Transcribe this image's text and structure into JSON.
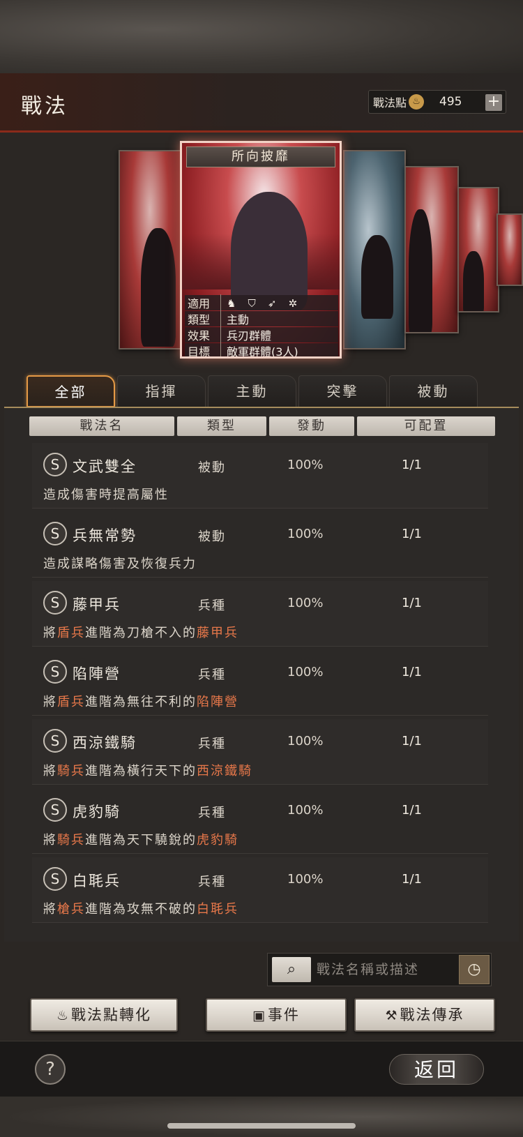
{
  "header": {
    "title": "戰法",
    "points_label": "戰法點",
    "points_icon": "flame-coin-icon",
    "points_value": "495",
    "points_add": "+"
  },
  "featured_card": {
    "title": "所向披靡",
    "info": [
      {
        "key": "適用",
        "value": ""
      },
      {
        "key": "類型",
        "value": "主動"
      },
      {
        "key": "效果",
        "value": "兵刃群體"
      },
      {
        "key": "目標",
        "value": "敵軍群體(3人)"
      }
    ],
    "applicable_icons": [
      "cavalry-icon",
      "shield-icon",
      "bow-icon",
      "spear-icon"
    ]
  },
  "tabs": [
    {
      "label": "全部",
      "active": true
    },
    {
      "label": "指揮",
      "active": false
    },
    {
      "label": "主動",
      "active": false
    },
    {
      "label": "突擊",
      "active": false
    },
    {
      "label": "被動",
      "active": false
    }
  ],
  "columns": [
    "戰法名",
    "類型",
    "發動",
    "可配置"
  ],
  "rows": [
    {
      "grade": "S",
      "name": "文武雙全",
      "type": "被動",
      "rate": "100%",
      "slot": "1/1",
      "desc": [
        {
          "t": "造成傷害時提高屬性",
          "h": false
        }
      ]
    },
    {
      "grade": "S",
      "name": "兵無常勢",
      "type": "被動",
      "rate": "100%",
      "slot": "1/1",
      "desc": [
        {
          "t": "造成謀略傷害及恢復兵力",
          "h": false
        }
      ]
    },
    {
      "grade": "S",
      "name": "藤甲兵",
      "type": "兵種",
      "rate": "100%",
      "slot": "1/1",
      "desc": [
        {
          "t": "將",
          "h": false
        },
        {
          "t": "盾兵",
          "h": true
        },
        {
          "t": "進階為刀槍不入的",
          "h": false
        },
        {
          "t": "藤甲兵",
          "h": true
        }
      ]
    },
    {
      "grade": "S",
      "name": "陷陣營",
      "type": "兵種",
      "rate": "100%",
      "slot": "1/1",
      "desc": [
        {
          "t": "將",
          "h": false
        },
        {
          "t": "盾兵",
          "h": true
        },
        {
          "t": "進階為無往不利的",
          "h": false
        },
        {
          "t": "陷陣營",
          "h": true
        }
      ]
    },
    {
      "grade": "S",
      "name": "西涼鐵騎",
      "type": "兵種",
      "rate": "100%",
      "slot": "1/1",
      "desc": [
        {
          "t": "將",
          "h": false
        },
        {
          "t": "騎兵",
          "h": true
        },
        {
          "t": "進階為橫行天下的",
          "h": false
        },
        {
          "t": "西涼鐵騎",
          "h": true
        }
      ]
    },
    {
      "grade": "S",
      "name": "虎豹騎",
      "type": "兵種",
      "rate": "100%",
      "slot": "1/1",
      "desc": [
        {
          "t": "將",
          "h": false
        },
        {
          "t": "騎兵",
          "h": true
        },
        {
          "t": "進階為天下驍銳的",
          "h": false
        },
        {
          "t": "虎豹騎",
          "h": true
        }
      ]
    },
    {
      "grade": "S",
      "name": "白毦兵",
      "type": "兵種",
      "rate": "100%",
      "slot": "1/1",
      "desc": [
        {
          "t": "將",
          "h": false
        },
        {
          "t": "槍兵",
          "h": true
        },
        {
          "t": "進階為攻無不破的",
          "h": false
        },
        {
          "t": "白毦兵",
          "h": true
        }
      ]
    }
  ],
  "search": {
    "placeholder": "戰法名稱或描述",
    "search_icon": "magnifier-icon",
    "history_icon": "clock-icon"
  },
  "actions": [
    {
      "label": "戰法點轉化",
      "icon": "flame-icon"
    },
    {
      "label": "事件",
      "icon": "event-icon"
    },
    {
      "label": "戰法傳承",
      "icon": "hammer-icon"
    }
  ],
  "footer": {
    "help": "?",
    "back": "返回"
  },
  "colors": {
    "accent": "#e59a46",
    "highlight": "#e8784a",
    "header_line": "#8a2a1a"
  }
}
